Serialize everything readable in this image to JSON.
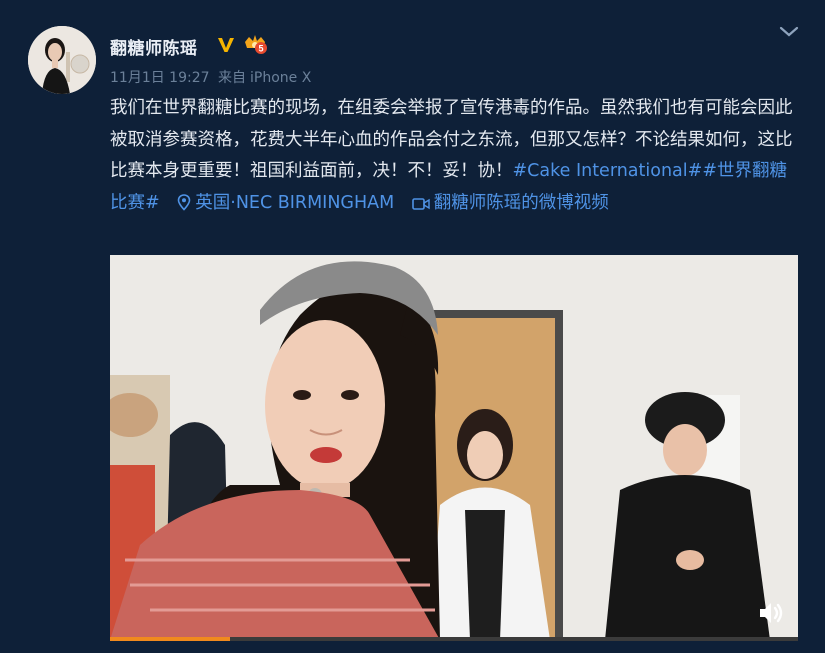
{
  "user": {
    "name": "翻糖师陈瑶",
    "verified_badge": "V",
    "vip_level": "5"
  },
  "meta": {
    "timestamp": "11月1日 19:27",
    "source_prefix": "来自",
    "device": "iPhone X"
  },
  "post": {
    "text_main": "我们在世界翻糖比赛的现场，在组委会举报了宣传港毒的作品。虽然我们也有可能会因此被取消参赛资格，花费大半年心血的作品会付之东流，但那又怎样？不论结果如何，这比比赛本身更重要！祖国利益面前，决！不！妥！协！",
    "hashtag1": "#Cake International#",
    "hashtag2": "#世界翻糖比赛#",
    "location": "英国·NEC BIRMINGHAM",
    "video_link": "翻糖师陈瑶的微博视频"
  },
  "video": {
    "progress_fraction": 0.175,
    "muted": true
  },
  "colors": {
    "background": "#0e2038",
    "link": "#4f93e6",
    "meta": "#6b8099",
    "verified": "#f5b400",
    "progress": "#f08a1e"
  },
  "icons": {
    "verified": "verified-v-icon",
    "vip": "vip-crown-icon",
    "location": "location-pin-icon",
    "video": "video-camera-icon",
    "menu": "chevron-down-icon",
    "mute": "speaker-muted-icon"
  }
}
